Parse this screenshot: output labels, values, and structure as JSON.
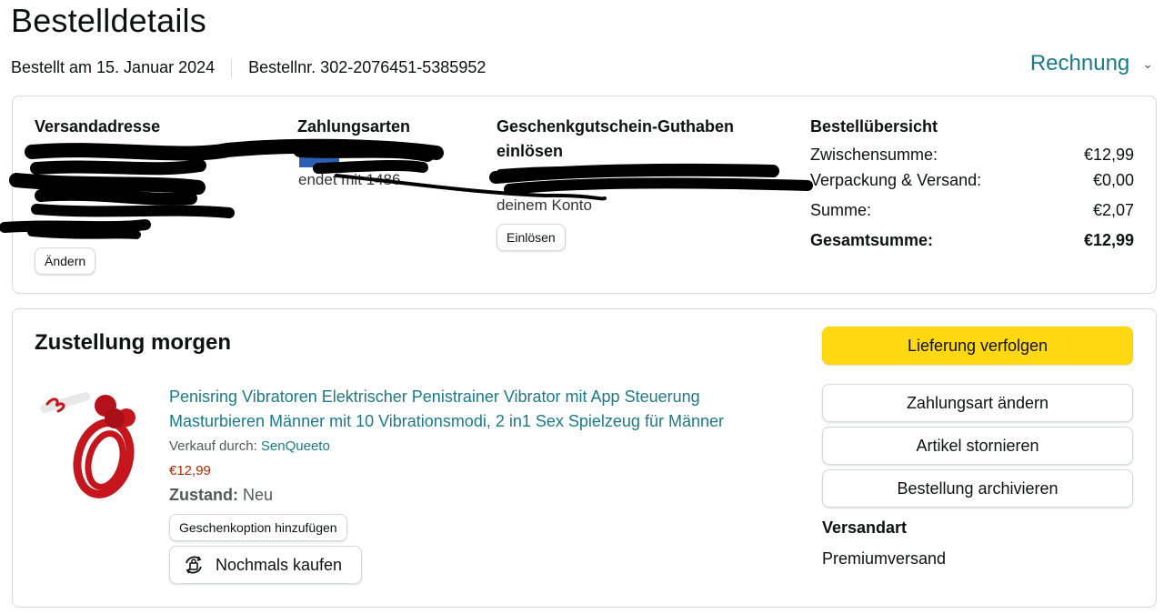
{
  "page_title": "Bestelldetails",
  "meta": {
    "ordered_on": "Bestellt am 15. Januar 2024",
    "order_number": "Bestellnr. 302-2076451-5385952"
  },
  "invoice_label": "Rechnung",
  "summary_card": {
    "address_heading": "Versandadresse",
    "address_change_label": "Ändern",
    "payment_heading": "Zahlungsarten",
    "payment_partial_1": "d",
    "payment_partial_2": "endet mit 1486",
    "giftcard_heading_1": "Geschenkgutschein-Guthaben",
    "giftcard_heading_2": "einlösen",
    "giftcard_partial": "deinem Konto",
    "giftcard_redeem_label": "Einlösen",
    "overview_heading": "Bestellübersicht",
    "overview_rows": [
      {
        "label": "Zwischensumme:",
        "value": "€12,99"
      },
      {
        "label": "Verpackung & Versand:",
        "value": "€0,00"
      },
      {
        "label": "Summe:",
        "value": "€2,07"
      },
      {
        "label": "Gesamtsumme:",
        "value": "€12,99"
      }
    ]
  },
  "delivery_card": {
    "heading": "Zustellung morgen",
    "product_title": "Penisring Vibratoren Elektrischer Penistrainer Vibrator mit App Steuerung Masturbieren Männer mit 10 Vibrationsmodi, 2 in1 Sex Spielzeug für Männer",
    "sold_by_label": "Verkauf durch:",
    "seller": "SenQueeto",
    "price": "€12,99",
    "condition_label": "Zustand:",
    "condition_value": "Neu",
    "gift_option_label": "Geschenkoption hinzufügen",
    "buy_again_label": "Nochmals kaufen",
    "actions": {
      "track": "Lieferung verfolgen",
      "change_payment": "Zahlungsart ändern",
      "cancel": "Artikel stornieren",
      "archive": "Bestellung archivieren"
    },
    "shipping_heading": "Versandart",
    "shipping_value": "Premiumversand"
  },
  "colors": {
    "link": "#1a7a8a",
    "primary_button": "#ffd814",
    "price": "#b12704",
    "product": "#c4161c"
  }
}
